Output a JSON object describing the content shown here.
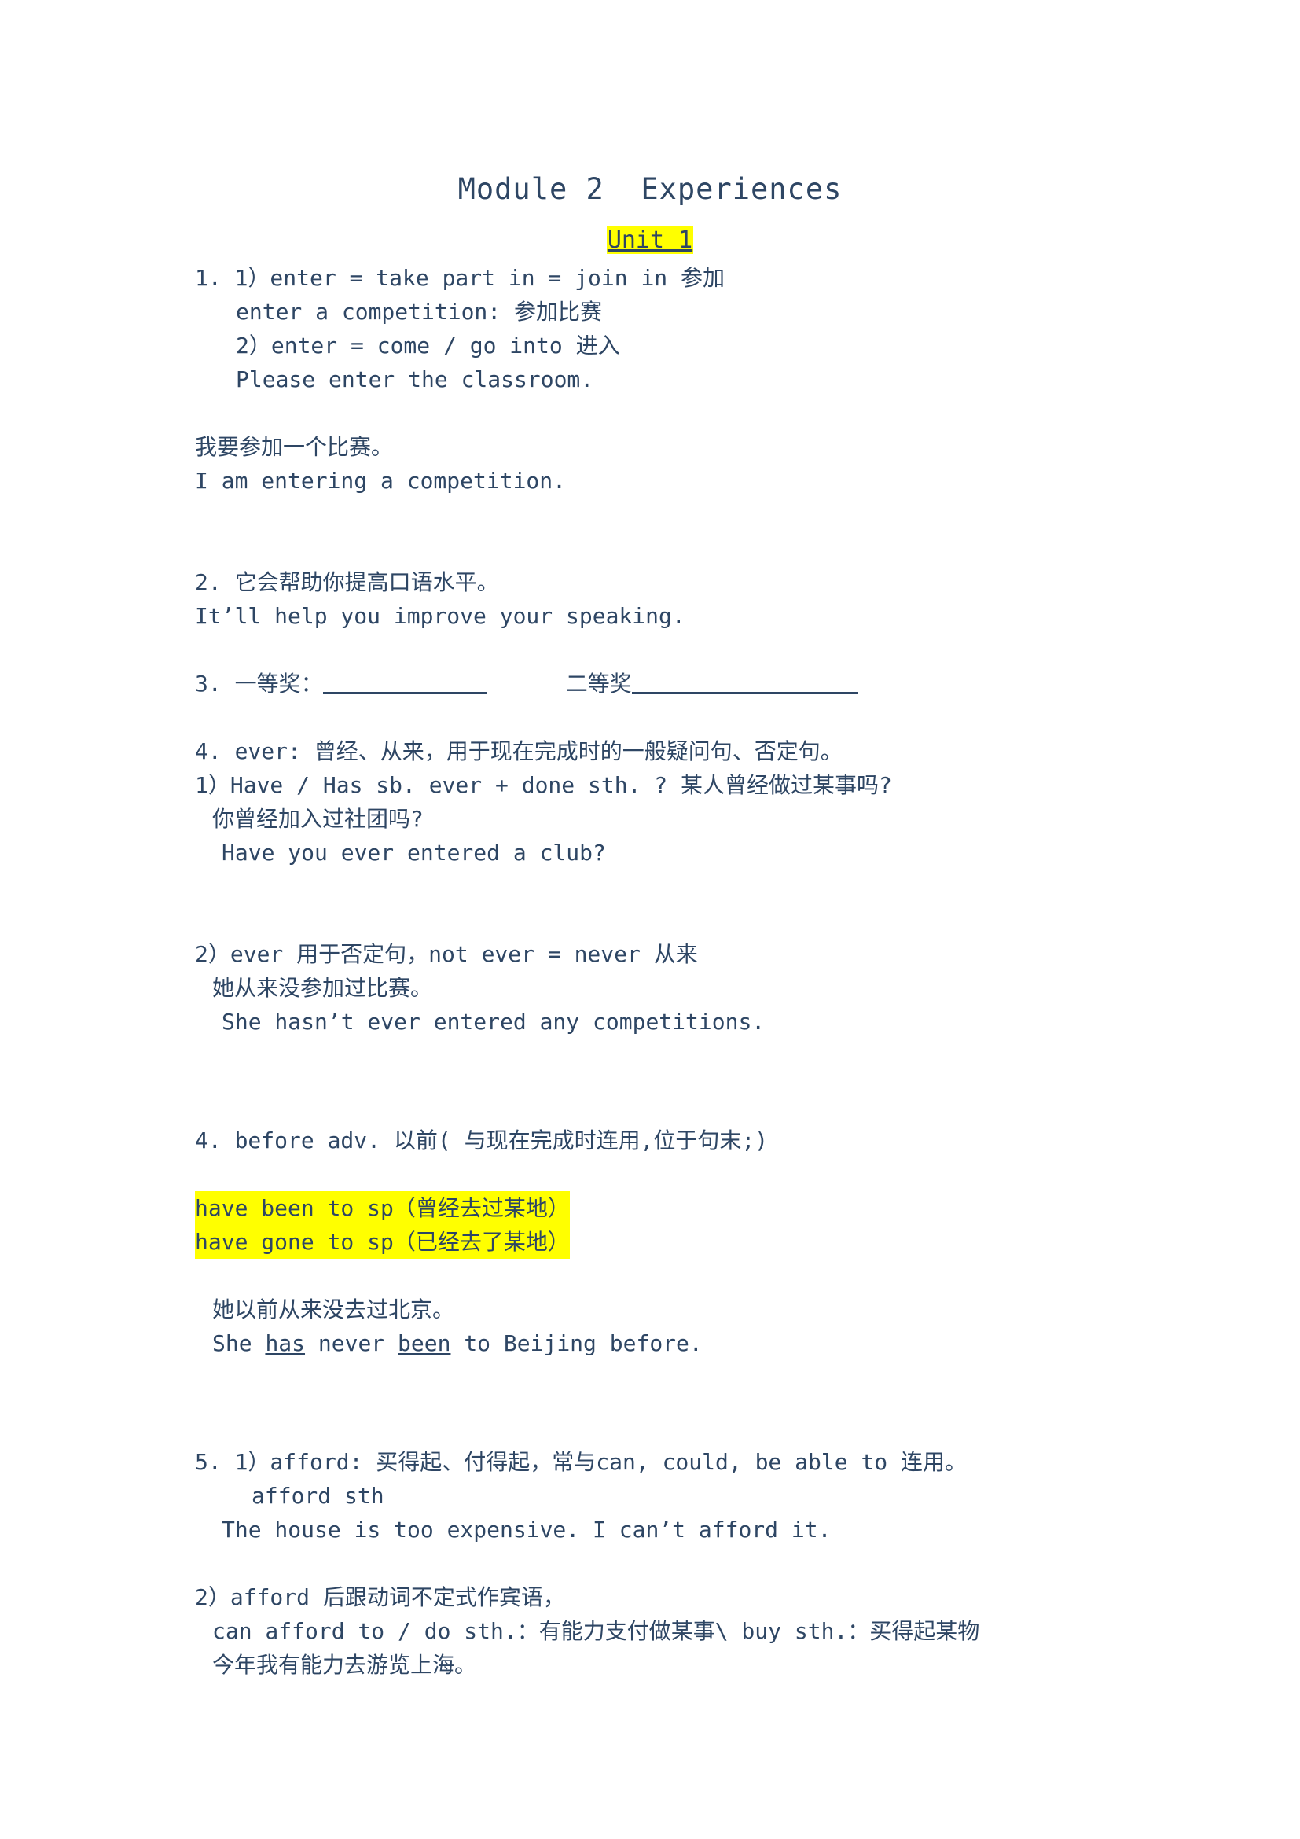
{
  "document": {
    "title": "Module 2  Experiences",
    "unit_heading": "Unit 1",
    "text_color": "#2e4664",
    "highlight_color": "#ffff00",
    "background_color": "#ffffff"
  },
  "sections": {
    "item1": {
      "line1": "1. 1）enter = take part in = join in 参加",
      "line2": "enter a competition: 参加比赛",
      "line3": "2）enter = come / go into 进入",
      "line4": "Please enter the classroom."
    },
    "example1": {
      "chinese": "我要参加一个比赛。",
      "english": "I am entering a competition."
    },
    "item2": {
      "line1": "2. 它会帮助你提高口语水平。",
      "line2": "It’ll help you improve your speaking."
    },
    "item3": {
      "label1": "3. 一等奖：",
      "label2": "二等奖",
      "blank1_value": "",
      "blank2_value": ""
    },
    "item4_ever": {
      "line1": "4. ever: 曾经、从来，用于现在完成时的一般疑问句、否定句。",
      "sub1_line1": "1）Have / Has sb. ever + done sth. ? 某人曾经做过某事吗?",
      "sub1_line2": "你曾经加入过社团吗?",
      "sub1_line3": "Have you ever entered a club?",
      "sub2_line1": "2）ever 用于否定句，not ever = never 从来",
      "sub2_line2": "她从来没参加过比赛。",
      "sub2_line3": "She hasn’t ever entered any competitions."
    },
    "item4_before": {
      "line1": "4. before adv. 以前( 与现在完成时连用,位于句末;)",
      "highlight1": "have been to sp（曾经去过某地）",
      "highlight2": "have gone to sp（已经去了某地）",
      "example_cn": "她以前从来没去过北京。",
      "example_en_pre": "She ",
      "example_en_u1": "has",
      "example_en_mid": " never ",
      "example_en_u2": "been",
      "example_en_post": " to Beijing before."
    },
    "item5_afford": {
      "sub1_line1": "5. 1）afford: 买得起、付得起，常与can, could, be able to 连用。",
      "sub1_line2": "afford sth",
      "sub1_line3": "The house is too expensive. I can’t afford it.",
      "sub2_line1": "2）afford 后跟动词不定式作宾语，",
      "sub2_line2": "can afford to / do sth.：有能力支付做某事\\ buy sth.：买得起某物",
      "sub2_line3": "今年我有能力去游览上海。"
    }
  }
}
